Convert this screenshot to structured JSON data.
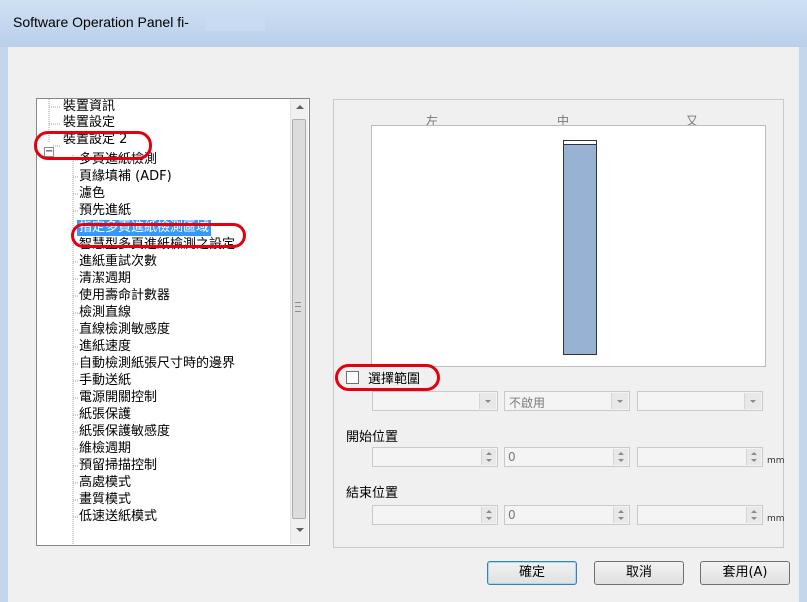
{
  "window": {
    "title": "Software Operation Panel fi-"
  },
  "tree": {
    "items": [
      {
        "label": "裝置資訊"
      },
      {
        "label": "裝置設定"
      },
      {
        "label": "裝置設定 2",
        "expander": "−"
      },
      {
        "label": "多頁進紙檢測"
      },
      {
        "label": "頁緣填補 (ADF)"
      },
      {
        "label": "濾色"
      },
      {
        "label": "預先進紙"
      },
      {
        "label": "指定多頁進紙檢測區域",
        "selected": true
      },
      {
        "label": "智慧型多頁進紙檢測之設定"
      },
      {
        "label": "進紙重試次數"
      },
      {
        "label": "清潔週期"
      },
      {
        "label": "使用壽命計數器"
      },
      {
        "label": "檢測直線"
      },
      {
        "label": "直線檢測敏感度"
      },
      {
        "label": "進紙速度"
      },
      {
        "label": "自動檢測紙張尺寸時的邊界"
      },
      {
        "label": "手動送紙"
      },
      {
        "label": "電源開關控制"
      },
      {
        "label": "紙張保護"
      },
      {
        "label": "紙張保護敏感度"
      },
      {
        "label": "維檢週期"
      },
      {
        "label": "預留掃描控制"
      },
      {
        "label": "高處模式"
      },
      {
        "label": "畫質模式"
      },
      {
        "label": "低速送紙模式"
      }
    ]
  },
  "preview": {
    "col_left": "左",
    "col_center": "中",
    "col_right": "又"
  },
  "select_range": {
    "label": "選擇範圍",
    "checked": false
  },
  "combos": {
    "first": "",
    "second": "不啟用",
    "third": ""
  },
  "start_position": {
    "label": "開始位置",
    "left": "",
    "center": "0",
    "right": "",
    "unit": "mm"
  },
  "end_position": {
    "label": "結束位置",
    "left": "",
    "center": "0",
    "right": "",
    "unit": "mm"
  },
  "buttons": {
    "ok": "確定",
    "cancel": "取消",
    "apply": "套用(A)"
  },
  "highlight_color": "#e3000f",
  "selection_color": "#3399ff"
}
